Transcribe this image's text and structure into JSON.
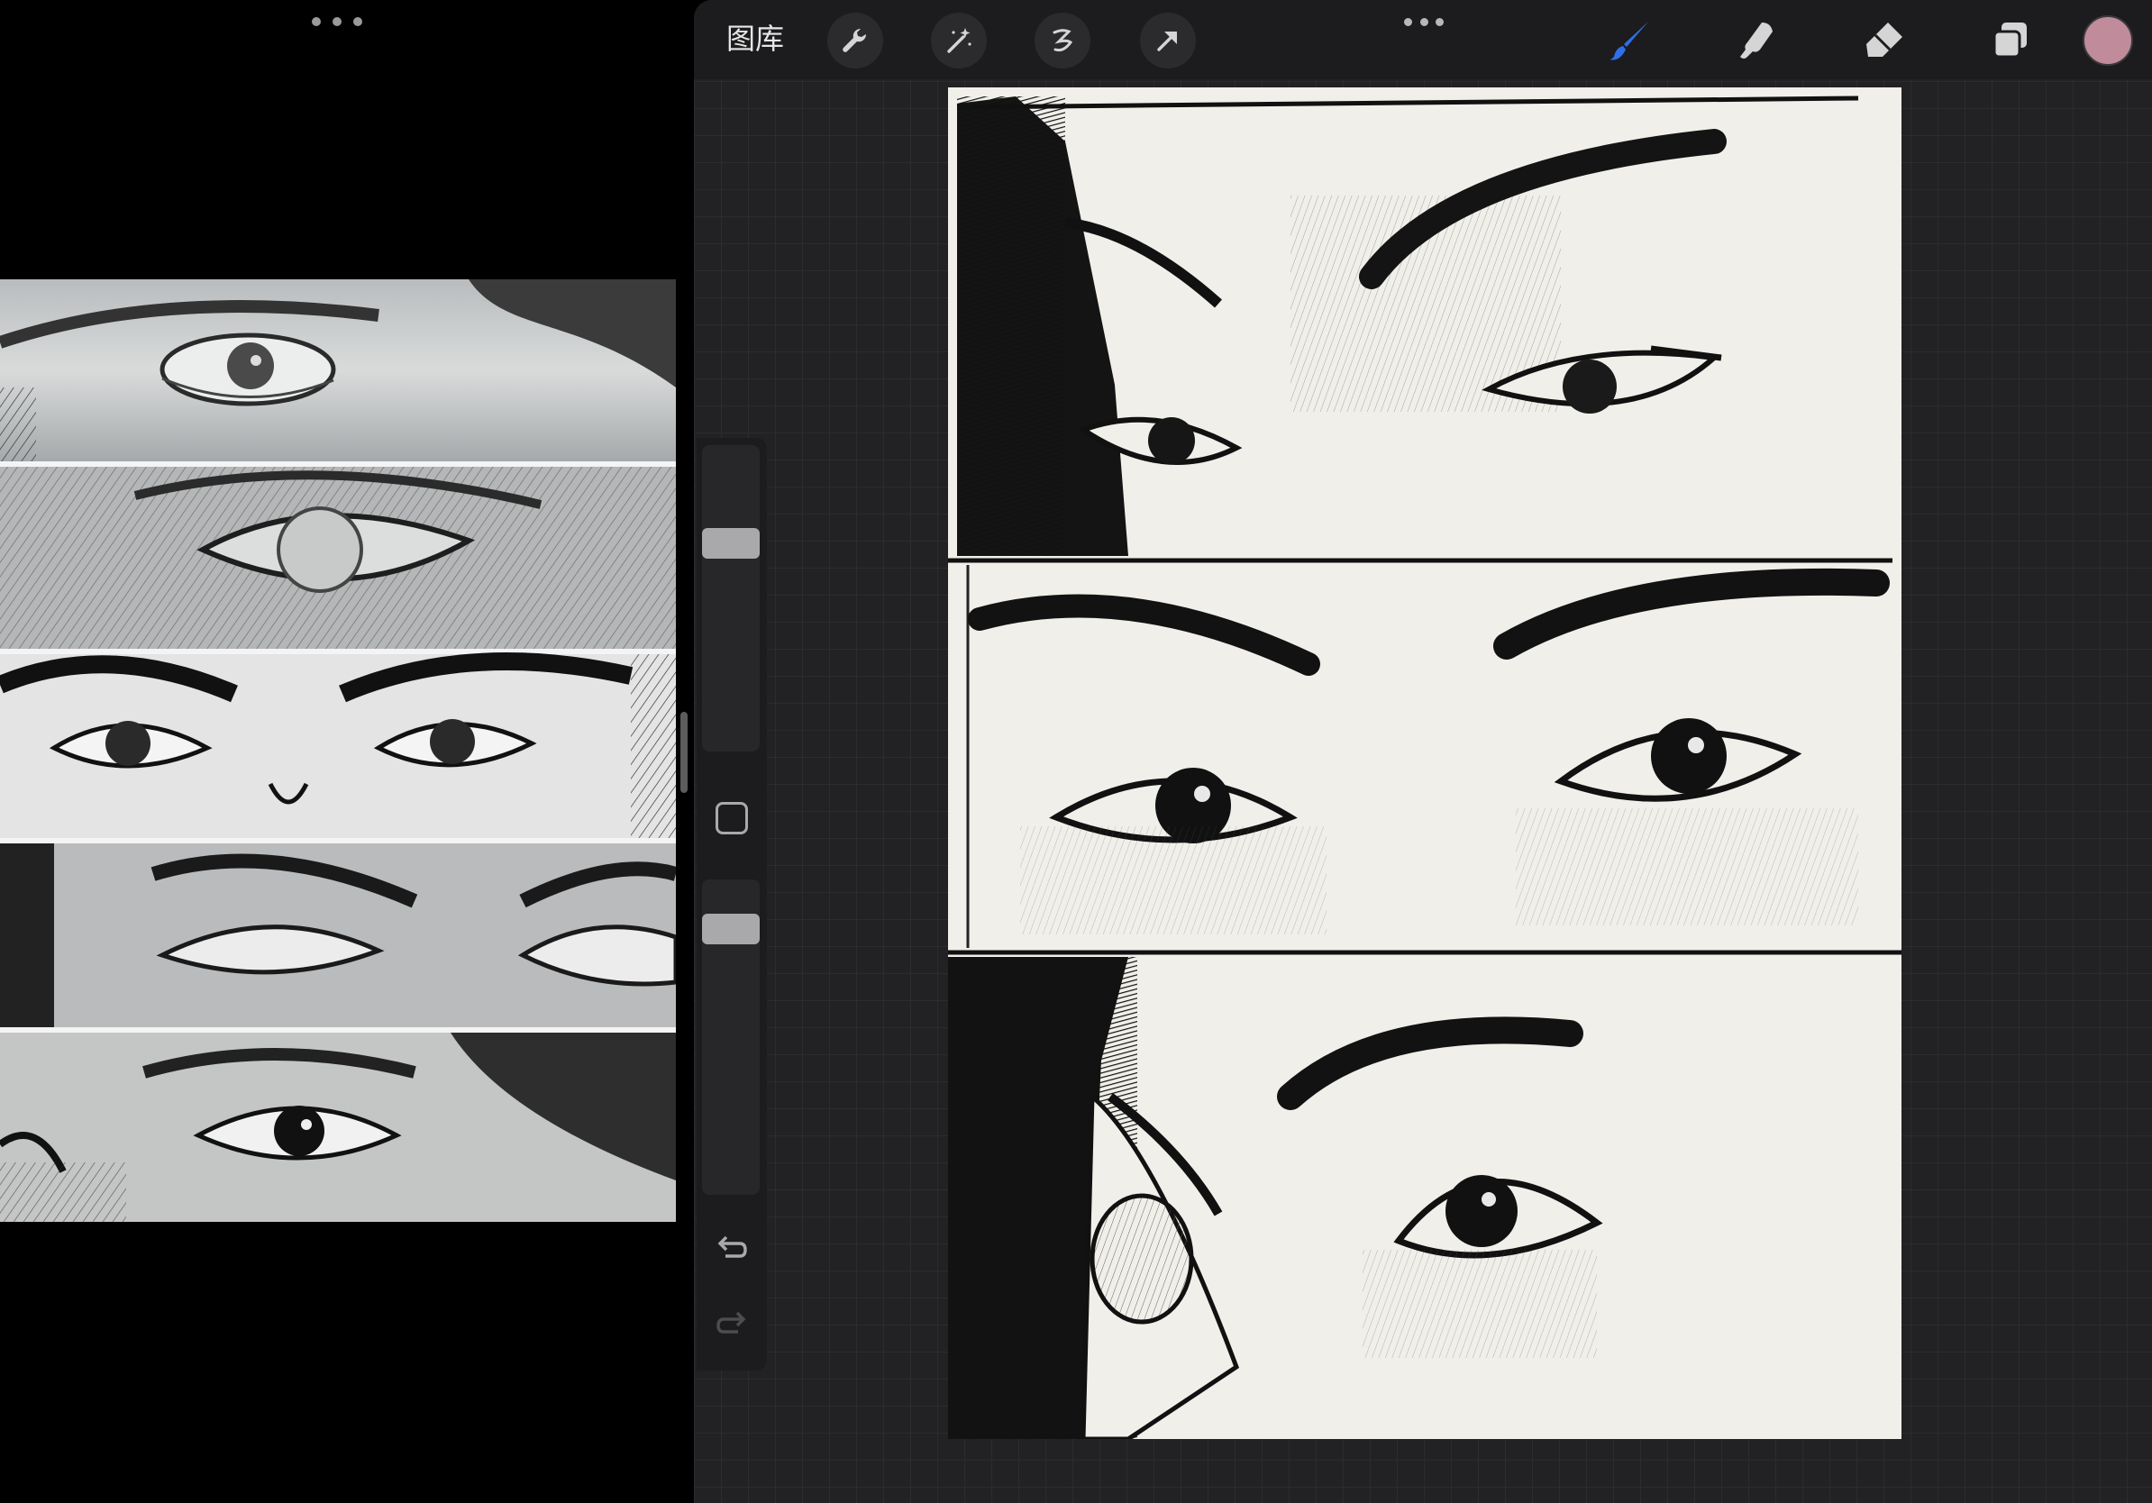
{
  "toolbar": {
    "gallery_label": "图库",
    "tools": [
      "wrench-icon",
      "magic-wand-icon",
      "selection-icon",
      "transform-arrow-icon"
    ],
    "right_tools": [
      "brush-icon",
      "smudge-icon",
      "eraser-icon",
      "layers-icon"
    ],
    "active_tool": "brush",
    "active_tool_color": "#2f6fe8",
    "current_color": "#c08b9b"
  },
  "sidebar": {
    "brush_size": 0.7,
    "opacity": 0.88
  },
  "colors": {
    "app_background": "#222224",
    "toolbar_background": "#1c1c1e",
    "canvas_paper": "#f1efe9"
  }
}
